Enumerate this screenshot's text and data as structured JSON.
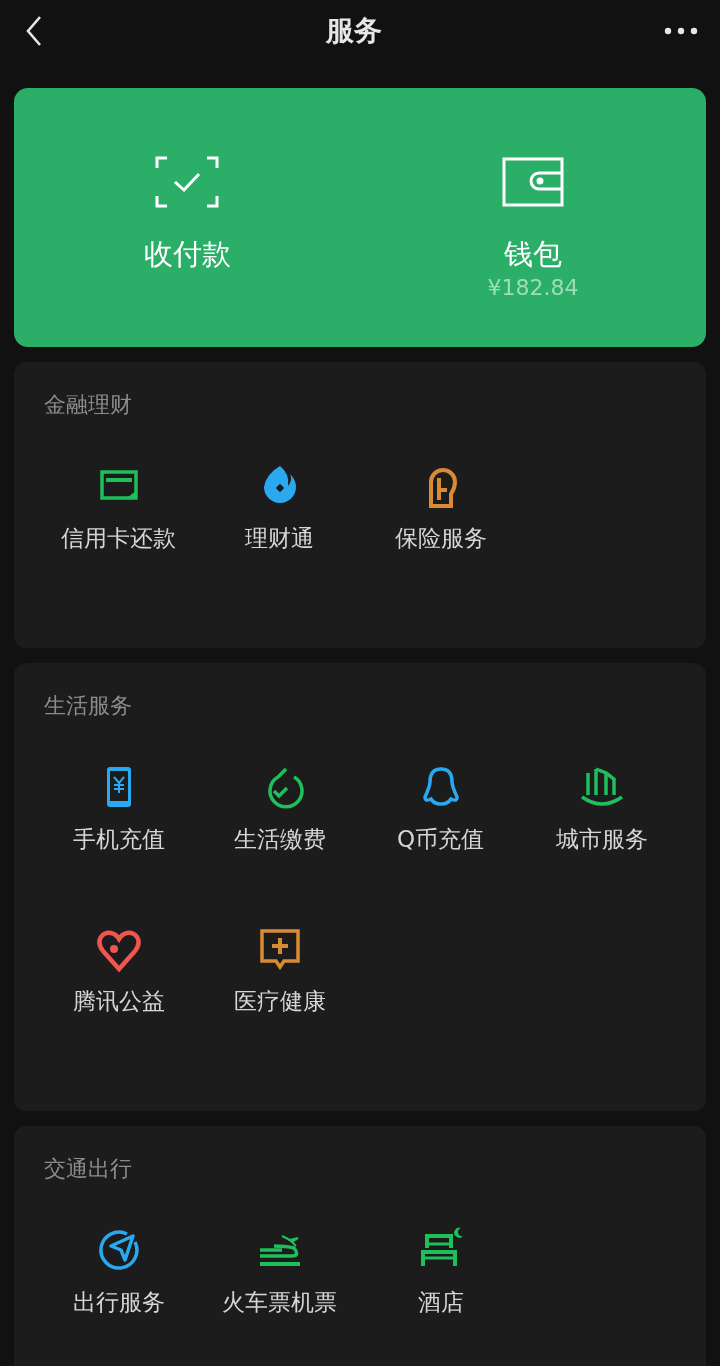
{
  "header": {
    "title": "服务"
  },
  "pay_card": {
    "items": [
      {
        "kind": "scan",
        "label": "收付款"
      },
      {
        "kind": "wallet",
        "label": "钱包",
        "amount": "¥182.84"
      }
    ]
  },
  "sections": [
    {
      "title": "金融理财",
      "items": [
        {
          "kind": "card",
          "color": "#1fbf5c",
          "label": "信用卡还款"
        },
        {
          "kind": "fund",
          "color": "#2aa8f0",
          "label": "理财通"
        },
        {
          "kind": "insurance",
          "color": "#d98a35",
          "label": "保险服务"
        }
      ]
    },
    {
      "title": "生活服务",
      "items": [
        {
          "kind": "phone",
          "color": "#2aa8f0",
          "label": "手机充值"
        },
        {
          "kind": "bill",
          "color": "#1fbf5c",
          "label": "生活缴费"
        },
        {
          "kind": "penguin",
          "color": "#2aa8f0",
          "label": "Q币充值"
        },
        {
          "kind": "city",
          "color": "#1fbf5c",
          "label": "城市服务"
        },
        {
          "kind": "heart",
          "color": "#f0554f",
          "label": "腾讯公益"
        },
        {
          "kind": "medical",
          "color": "#d98a35",
          "label": "医疗健康"
        }
      ]
    },
    {
      "title": "交通出行",
      "items": [
        {
          "kind": "navigate",
          "color": "#2aa8f0",
          "label": "出行服务"
        },
        {
          "kind": "train",
          "color": "#1fbf5c",
          "label": "火车票机票"
        },
        {
          "kind": "hotel",
          "color": "#1fbf5c",
          "label": "酒店"
        }
      ]
    }
  ]
}
